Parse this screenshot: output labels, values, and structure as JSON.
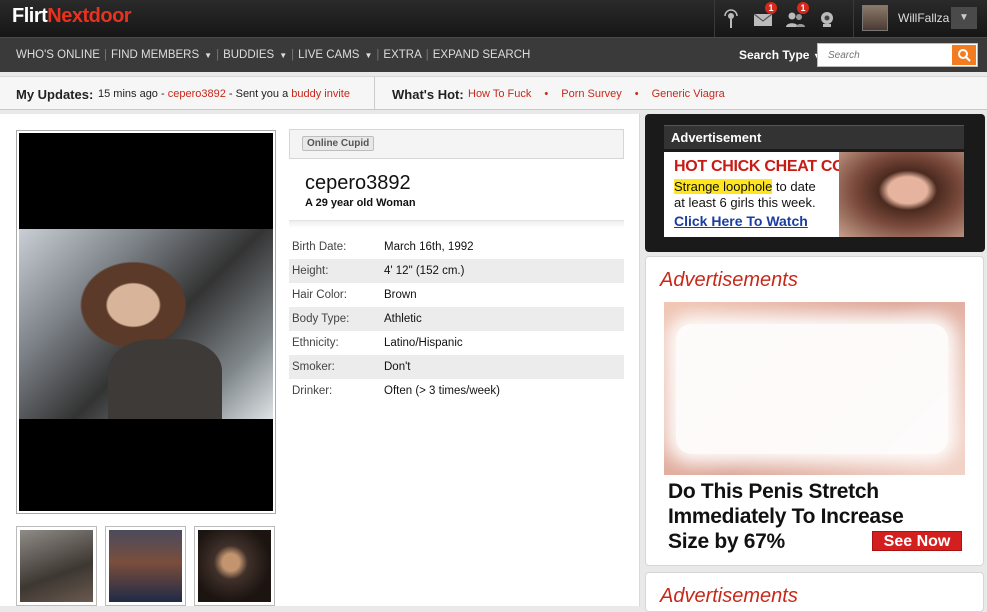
{
  "app": {
    "logo_part1": "Flirt",
    "logo_part2": "Ne",
    "logo_part3": "tdoor",
    "logo_part4": "x"
  },
  "topbar": {
    "icons": [
      {
        "name": "broadcast-icon",
        "badge": ""
      },
      {
        "name": "mail-icon",
        "badge": "1"
      },
      {
        "name": "buddies-icon",
        "badge": "1"
      },
      {
        "name": "webcam-icon",
        "badge": ""
      }
    ],
    "username": "WillFallza",
    "user_caret": "▼"
  },
  "nav": {
    "items": [
      {
        "label": "WHO'S ONLINE",
        "has_caret": false
      },
      {
        "label": "FIND MEMBERS",
        "has_caret": true
      },
      {
        "label": "BUDDIES",
        "has_caret": true
      },
      {
        "label": "LIVE CAMS",
        "has_caret": true
      },
      {
        "label": "EXTRA",
        "has_caret": false
      },
      {
        "label": "EXPAND SEARCH",
        "has_caret": false
      }
    ],
    "search_type_label": "Search Type",
    "search_placeholder": "Search"
  },
  "updates": {
    "label": "My Updates:",
    "time": "15 mins ago",
    "dash1": " - ",
    "user": "cepero3892",
    "action": " - Sent you a ",
    "action_link": "buddy invite",
    "hot_label": "What's Hot:",
    "hot_links": [
      "How To Fuck",
      "Porn Survey",
      "Generic Viagra"
    ]
  },
  "profile": {
    "status": "Online Cupid",
    "username": "cepero3892",
    "subtitle": "A 29 year old Woman",
    "details": [
      {
        "key": "Birth Date:",
        "value": "March 16th, 1992"
      },
      {
        "key": "Height:",
        "value": "4' 12\" (152 cm.)"
      },
      {
        "key": "Hair Color:",
        "value": "Brown"
      },
      {
        "key": "Body Type:",
        "value": "Athletic"
      },
      {
        "key": "Ethnicity:",
        "value": "Latino/Hispanic"
      },
      {
        "key": "Smoker:",
        "value": "Don't"
      },
      {
        "key": "Drinker:",
        "value": "Often (> 3 times/week)"
      }
    ]
  },
  "sidebar": {
    "ad1": {
      "header": "Advertisement",
      "title": "HOT CHICK CHEAT CODE",
      "highlight": "Strange loophole",
      "line1_rest": " to date",
      "line2": "at least 6 girls this week.",
      "link": "Click Here To Watch"
    },
    "ad2": {
      "title": "Advertisements",
      "text_line1": "Do This Penis Stretch",
      "text_line2": "Immediately To Increase",
      "text_line3": "Size by 67%",
      "button": "See Now"
    },
    "ad3": {
      "title": "Advertisements"
    }
  },
  "colors": {
    "accent_red": "#c8281a",
    "search_orange": "#f47c20",
    "link_blue": "#1a3ea0"
  }
}
